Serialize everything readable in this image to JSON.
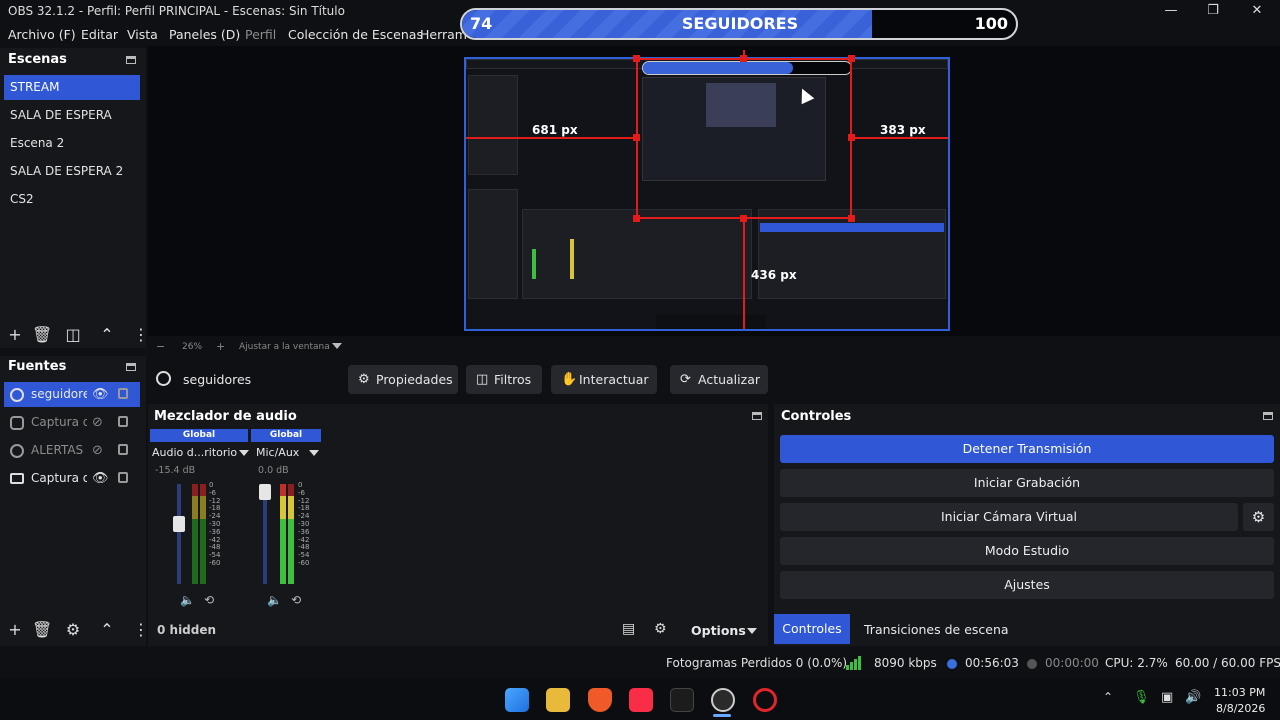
{
  "window": {
    "title": "OBS 32.1.2 - Perfil: Perfil PRINCIPAL - Escenas: Sin Título"
  },
  "menu": [
    "Archivo (F)",
    "Editar",
    "Vista",
    "Paneles (D)",
    "Perfil",
    "Colección de Escenas",
    "Herram"
  ],
  "follower_bar": {
    "label": "SEGUIDORES",
    "current": "74",
    "max": "100",
    "progress": 0.74
  },
  "scenes": {
    "title": "Escenas",
    "items": [
      "STREAM",
      "SALA DE ESPERA",
      "Escena 2",
      "SALA DE ESPERA 2",
      "CS2"
    ],
    "selected": 0
  },
  "sources": {
    "title": "Fuentes",
    "items": [
      {
        "label": "seguidore",
        "icon": "globe-icon",
        "visible": true
      },
      {
        "label": "Captura d",
        "icon": "gamepad-icon",
        "visible": false
      },
      {
        "label": "ALERTAS",
        "icon": "globe-icon",
        "visible": false
      },
      {
        "label": "Captura d",
        "icon": "monitor-icon",
        "visible": true
      }
    ],
    "selected": 0
  },
  "preview": {
    "measure_left": "681 px",
    "measure_right": "383 px",
    "measure_bottom": "436 px"
  },
  "zoom": {
    "value": "26%",
    "fit_label": "Ajustar a la ventana"
  },
  "source_toolbar": {
    "source_name": "seguidores",
    "properties": "Propiedades",
    "filters": "Filtros",
    "interact": "Interactuar",
    "refresh": "Actualizar"
  },
  "mixer": {
    "title": "Mezclador de audio",
    "channels": [
      {
        "header": "Global",
        "name": "Audio d...ritorio",
        "db": "-15.4 dB",
        "level": 0.62
      },
      {
        "header": "Global",
        "name": "Mic/Aux",
        "db": "0.0 dB",
        "level": 1.0
      }
    ],
    "scale": [
      "0",
      "-6",
      "-12",
      "-18",
      "-24",
      "-30",
      "-36",
      "-42",
      "-48",
      "-54",
      "-60"
    ],
    "hidden": "0 hidden",
    "options": "Options"
  },
  "controls": {
    "title": "Controles",
    "buttons": [
      "Detener Transmisión",
      "Iniciar Grabación",
      "Iniciar Cámara Virtual",
      "Modo Estudio",
      "Ajustes"
    ],
    "tabs": [
      "Controles",
      "Transiciones de escena"
    ]
  },
  "status": {
    "dropped": "Fotogramas Perdidos 0 (0.0%)",
    "bitrate": "8090 kbps",
    "stream_time": "00:56:03",
    "rec_time": "00:00:00",
    "cpu": "CPU: 2.7%",
    "fps": "60.00 / 60.00 FPS"
  },
  "taskbar": {
    "time": "11:03 PM",
    "date": "8/8/2026"
  },
  "colors": {
    "accent": "#2f57d6",
    "red_guides": "#e21b1b",
    "meter_green": "#3fbf3f",
    "meter_yellow": "#d6c637",
    "meter_red": "#c0302a"
  }
}
